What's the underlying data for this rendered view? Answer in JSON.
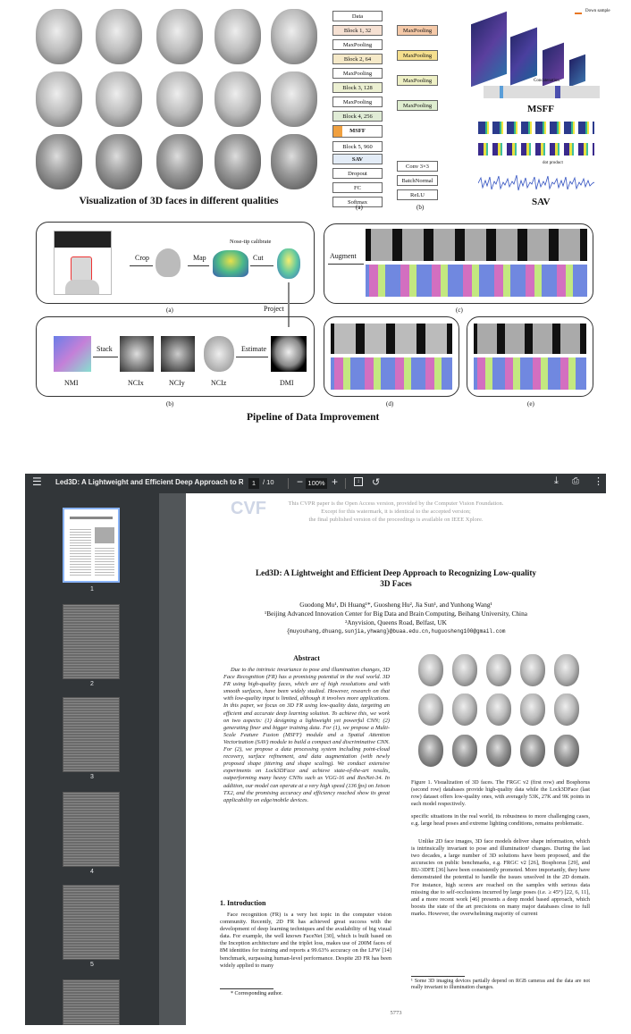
{
  "figure_top": {
    "qualities_caption": "Visualization of 3D faces in different qualities",
    "network": {
      "blocks": [
        "Data",
        "Block 1, 32",
        "MaxPooling",
        "Block 2, 64",
        "MaxPooling",
        "Block 3, 128",
        "MaxPooling",
        "Block 4, 256",
        "MSFF",
        "Block 5, 960",
        "SAV",
        "Dropout",
        "FC",
        "Softmax"
      ],
      "side": [
        "MaxPooling",
        "MaxPooling",
        "MaxPooling",
        "MaxPooling"
      ],
      "legend": [
        "Conv 3×3",
        "BatchNormal",
        "ReLU"
      ],
      "sub_a": "(a)",
      "sub_b": "(b)",
      "msff_title": "MSFF",
      "sav_title": "SAV",
      "downsample": "Down sample",
      "concatenation": "Concatenation",
      "dot_product": "dot product"
    },
    "pipeline": {
      "labels": [
        "Crop",
        "Map",
        "Cut",
        "Augment",
        "Project",
        "Estimate",
        "Stack"
      ],
      "nose_tip": "Nose-tip calibrate",
      "bottom_labels": [
        "NMI",
        "NCIx",
        "NCIy",
        "NCIz",
        "DMI"
      ],
      "sub": [
        "(a)",
        "(b)",
        "(c)",
        "(d)",
        "(e)"
      ],
      "caption": "Pipeline of Data Improvement"
    }
  },
  "viewer": {
    "doc_title": "Led3D: A Lightweight and Efficient Deep Approach to Rec...",
    "page_current": "1",
    "page_total": "/ 10",
    "zoom": "100%",
    "thumbnails": [
      "1",
      "2",
      "3",
      "4",
      "5"
    ],
    "paper": {
      "watermark_line1": "This CVPR paper is the Open Access version, provided by the Computer Vision Foundation.",
      "watermark_line2": "Except for this watermark, it is identical to the accepted version;",
      "watermark_line3": "the final published version of the proceedings is available on IEEE Xplore.",
      "logo": "CVF",
      "title_line1": "Led3D: A Lightweight and Efficient Deep Approach to Recognizing Low-quality",
      "title_line2": "3D Faces",
      "authors": "Guodong Mu¹, Di Huang¹*, Guosheng Hu², Jia Sun¹, and Yunhong Wang¹",
      "affil1": "¹Beijing Advanced Innovation Center for Big Data and Brain Computing, Beihang University, China",
      "affil2": "²Anyvision, Queens Road, Belfast, UK",
      "emails": "{muyouhang,dhuang,sunjia,yhwang}@buaa.edu.cn,huguosheng100@gmail.com",
      "abstract_heading": "Abstract",
      "abstract": "Due to the intrinsic invariance to pose and illumination changes, 3D Face Recognition (FR) has a promising potential in the real world. 3D FR using high-quality faces, which are of high resolutions and with smooth surfaces, have been widely studied. However, research on that with low-quality input is limited, although it involves more applications. In this paper, we focus on 3D FR using low-quality data, targeting an efficient and accurate deep learning solution. To achieve this, we work on two aspects: (1) designing a lightweight yet powerful CNN; (2) generating finer and bigger training data. For (1), we propose a Multi-Scale Feature Fusion (MSFF) module and a Spatial Attention Vectorization (SAV) module to build a compact and discriminative CNN. For (2), we propose a data processing system including point-cloud recovery, surface refinement, and data augmentation (with newly proposed shape jittering and shape scaling). We conduct extensive experiments on Lock3DFace and achieve state-of-the-art results, outperforming many heavy CNNs such as VGG-16 and ResNet-34. In addition, our model can operate at a very high speed (136 fps) on Jetson TX2, and the promising accuracy and efficiency reached show its great applicability on edge/mobile devices.",
      "intro_heading": "1. Introduction",
      "intro": "Face recognition (FR) is a very hot topic in the computer vision community. Recently, 2D FR has achieved great success with the development of deep learning techniques and the availability of big visual data. For example, the well known FaceNet [30], which is built based on the Inception architecture and the triplet loss, makes use of 200M faces of 8M identities for training and reports a 99.63% accuracy on the LFW [14] benchmark, surpassing human-level performance. Despite 2D FR has been widely applied to many",
      "corresponding": "* Corresponding author.",
      "fig1_caption": "Figure 1. Visualization of 3D faces. The FRGC v2 (first row) and Bosphorus (second row) databases provide high-quality data while the Lock3DFace (last row) dataset offers low-quality ones, with averagely 53K, 27K and 9K points in each model respectively.",
      "right_col": "specific situations in the real world, its robustness to more challenging cases, e.g. large head poses and extreme lighting conditions, remains problematic.",
      "right_col2": "Unlike 2D face images, 3D face models deliver shape information, which is intrinsically invariant to pose and illumination¹ changes. During the last two decades, a large number of 3D solutions have been proposed, and the accuracies on public benchmarks, e.g. FRGC v2 [26], Bosphorus [29], and BU-3DFE [36] have been consistently promoted. More importantly, they have demonstrated the potential to handle the issues unsolved in the 2D domain. For instance, high scores are reached on the samples with serious data missing due to self-occlusions incurred by large poses (i.e. ≥ 45°) [22, 6, 11], and a more recent work [46] presents a deep model based approach, which boosts the state of the art precisions on many major databases close to full marks. However, the overwhelming majority of current",
      "footnote": "¹ Some 3D imaging devices partially depend on RGB cameras and the data are not really invariant to illumination changes.",
      "page_number": "5773"
    }
  }
}
